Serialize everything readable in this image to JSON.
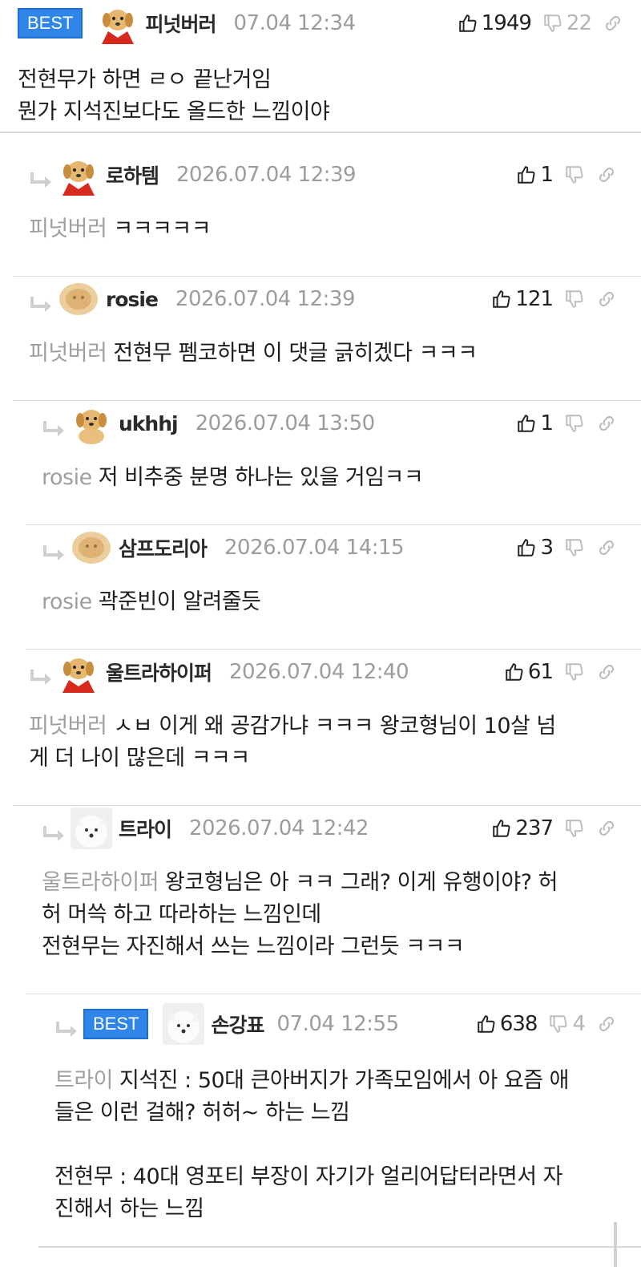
{
  "comments": [
    {
      "best": true,
      "best_label": "BEST",
      "nick": "피넛버러",
      "date": "07.04 12:34",
      "likes": "1949",
      "dislikes": "22",
      "avatar": "puppy-red",
      "lines": [
        "전현무가 하면 ㄹㅇ 끝난거임",
        "뭔가 지석진보다도 올드한 느낌이야"
      ]
    },
    {
      "nick": "로하템",
      "date": "2026.07.04 12:39",
      "likes": "1",
      "avatar": "puppy-red",
      "mention": "피넛버러",
      "lines": [
        "ㅋㅋㅋㅋㅋ"
      ]
    },
    {
      "nick": "rosie",
      "date": "2026.07.04 12:39",
      "likes": "121",
      "avatar": "blur",
      "mention": "피넛버러",
      "lines": [
        "전현무 펨코하면 이 댓글 긁히겠다 ㅋㅋㅋ"
      ]
    },
    {
      "nick": "ukhhj",
      "date": "2026.07.04 13:50",
      "likes": "1",
      "avatar": "puppy",
      "mention": "rosie",
      "lines": [
        "저 비추중 분명 하나는 있을 거임ㅋㅋ"
      ]
    },
    {
      "nick": "삼프도리아",
      "date": "2026.07.04 14:15",
      "likes": "3",
      "avatar": "blur",
      "mention": "rosie",
      "lines": [
        "곽준빈이 알려줄듯"
      ]
    },
    {
      "nick": "울트라하이퍼",
      "date": "2026.07.04 12:40",
      "likes": "61",
      "avatar": "puppy-red",
      "mention": "피넛버러",
      "lines": [
        "ㅅㅂ 이게 왜 공감가냐 ㅋㅋㅋ 왕코형님이 10살 넘",
        "게 더 나이 많은데 ㅋㅋㅋ"
      ]
    },
    {
      "nick": "트라이",
      "date": "2026.07.04 12:42",
      "likes": "237",
      "avatar": "samoyed",
      "mention": "울트라하이퍼",
      "lines": [
        "왕코형님은 아 ㅋㅋ 그래? 이게 유행이야? 허",
        "허 머쓱 하고 따라하는 느낌인데",
        "전현무는 자진해서 쓰는 느낌이라 그런듯 ㅋㅋㅋ"
      ]
    },
    {
      "best": true,
      "best_label": "BEST",
      "nick": "손강표",
      "date": "07.04 12:55",
      "likes": "638",
      "dislikes": "4",
      "avatar": "samoyed",
      "mention": "트라이",
      "lines": [
        "지석진 : 50대 큰아버지가 가족모임에서 아 요즘 애",
        "들은 이런 걸해? 허허~ 하는 느낌",
        "",
        "전현무 : 40대 영포티 부장이 자기가 얼리어답터라면서 자",
        "진해서 하는 느낌"
      ]
    }
  ],
  "icons": {
    "like": "thumbs-up-icon",
    "dislike": "thumbs-down-icon",
    "share": "link-icon",
    "reply": "reply-arrow-icon"
  },
  "colors": {
    "best_badge": "#2f86e8",
    "mention": "#9f9f9f",
    "date": "#9c9c9c"
  }
}
